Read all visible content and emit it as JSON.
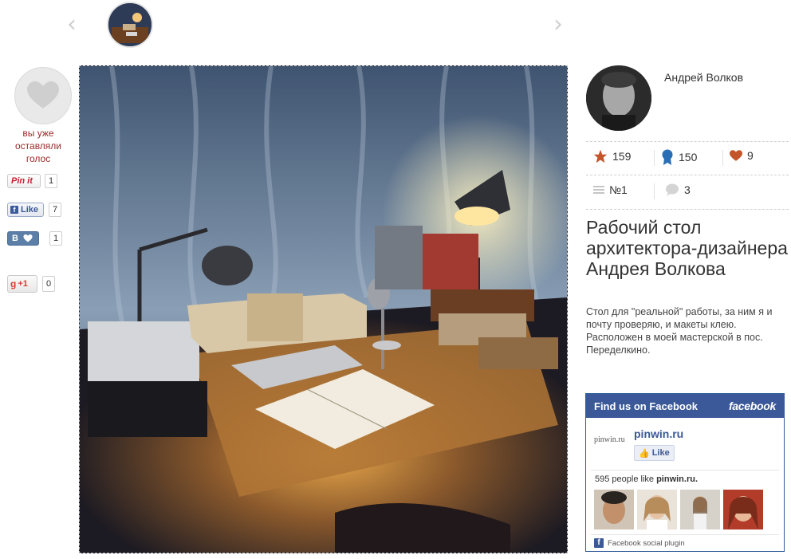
{
  "nav": {
    "prev_icon": "chevron-left-icon",
    "next_icon": "chevron-right-icon",
    "prev_glyph": "‹",
    "next_glyph": "›"
  },
  "vote": {
    "text": "вы уже оставляли голос",
    "icon": "heart-icon"
  },
  "share": {
    "pinterest": {
      "label": "Pin it",
      "count": "1"
    },
    "facebook": {
      "label": "Like",
      "count": "7"
    },
    "vk": {
      "label": "В",
      "count": "1"
    },
    "gplus": {
      "label": "+1",
      "count": "0"
    }
  },
  "author": {
    "name": "Андрей Волков"
  },
  "stats": {
    "stars": "159",
    "awards": "150",
    "likes": "9",
    "rank": "№1",
    "comments": "3"
  },
  "post": {
    "title": "Рабочий стол архитектора-дизайнера Андрея Волкова",
    "description": "Стол для \"реальной\" работы, за ним я и почту проверяю, и макеты клею. Расположен в моей мастерской в пос. Переделкино."
  },
  "facebook_box": {
    "header": "Find us on Facebook",
    "logo": "facebook",
    "page_logo": "pinwin.ru",
    "page_name": "pinwin.ru",
    "like_label": "Like",
    "people_count": "595",
    "people_text": "people like",
    "people_target": "pinwin.ru.",
    "plugin_label": "Facebook social plugin"
  },
  "colors": {
    "accent_red": "#9b2b2b",
    "facebook_blue": "#3b5998",
    "star": "#c4552b",
    "award": "#2a6fb6"
  }
}
